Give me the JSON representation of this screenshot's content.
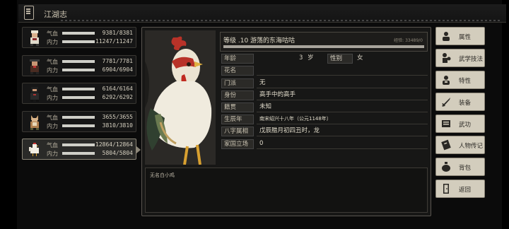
{
  "header": {
    "title": "江湖志"
  },
  "characters": [
    {
      "hp_label": "气血",
      "mp_label": "内力",
      "hp": "9381/8381",
      "mp": "11247/11247",
      "hp_frac": 1.0,
      "mp_frac": 1.0
    },
    {
      "hp_label": "气血",
      "mp_label": "内力",
      "hp": "7781/7781",
      "mp": "6904/6904",
      "hp_frac": 1.0,
      "mp_frac": 1.0
    },
    {
      "hp_label": "气血",
      "mp_label": "内力",
      "hp": "6164/6164",
      "mp": "6292/6292",
      "hp_frac": 1.0,
      "mp_frac": 1.0
    },
    {
      "hp_label": "气血",
      "mp_label": "内力",
      "hp": "3655/3655",
      "mp": "3810/3810",
      "hp_frac": 1.0,
      "mp_frac": 1.0
    },
    {
      "hp_label": "气血",
      "mp_label": "内力",
      "hp": "12864/12864",
      "mp": "5804/5804",
      "hp_frac": 1.0,
      "mp_frac": 1.0
    }
  ],
  "profile": {
    "level": "等级 .10  游荡的东海咕咕",
    "exp": "经验: 33489/0",
    "age_label": "年龄",
    "age": "3",
    "age_unit": "岁",
    "gender_label": "性别",
    "gender": "女",
    "alias_label": "花名",
    "alias": "",
    "sect_label": "门派",
    "sect": "无",
    "identity_label": "身份",
    "identity": "高手中的高手",
    "origin_label": "籍贯",
    "origin": "未知",
    "birth_label": "生辰年",
    "birth": "南宋绍兴十八年（公元1148年）",
    "bazi_label": "八字属相",
    "bazi": "戊辰腊月初四丑时，龙",
    "stance_label": "家国立场",
    "stance": "0",
    "description": "无名白小鸡"
  },
  "menu": [
    "属性",
    "武学技法",
    "特性",
    "装备",
    "武功",
    "人物传记",
    "背包",
    "返回"
  ]
}
